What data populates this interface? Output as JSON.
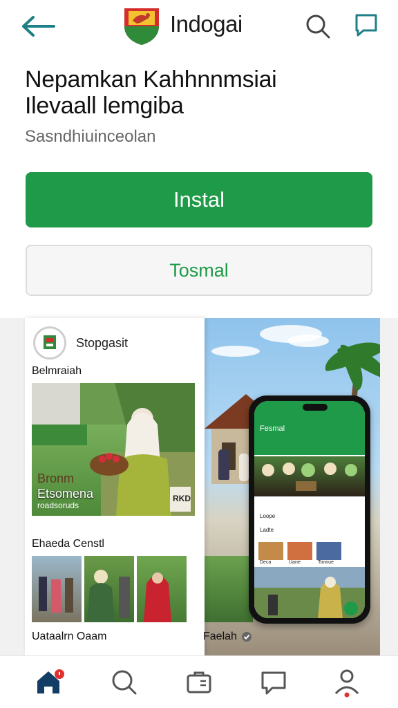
{
  "header": {
    "brand": "Indogai",
    "back_icon": "arrow-left-icon",
    "search_icon": "search-icon",
    "chat_icon": "chat-icon",
    "accent": "#1f7f86"
  },
  "app": {
    "title_line1": "Nepamkan Kahhnnmsiai",
    "title_line2": "Ilevaall lemgiba",
    "subtitle": "Sasndhiuinceolan",
    "install_label": "Instal",
    "secondary_label": "Tosmal",
    "primary_color": "#1f9a48"
  },
  "screenshot": {
    "card": {
      "brand": "Stopgasit",
      "section1": "Belmraiah",
      "overlay_line1": "Bronm",
      "overlay_line2": "Etsomena",
      "overlay_line3": "roadsoruds",
      "overlay_badge": "RKD",
      "section2": "Ehaeda Censtl",
      "footer": "Uataalrn Oaam"
    },
    "right_caption": "Faelah",
    "phone": {
      "app_label": "Fesmal",
      "row1": "Loope",
      "row2": "Ladte",
      "thumb_labels": [
        "Deca",
        "Uane",
        "Tonnue"
      ]
    }
  },
  "bottom_nav": {
    "items": [
      {
        "name": "home",
        "icon": "home-icon",
        "active": true
      },
      {
        "name": "search",
        "icon": "search-icon"
      },
      {
        "name": "library",
        "icon": "briefcase-icon"
      },
      {
        "name": "messages",
        "icon": "chat-icon"
      },
      {
        "name": "profile",
        "icon": "person-icon"
      }
    ],
    "home_color": "#143d66",
    "badge_color": "#e03131"
  }
}
